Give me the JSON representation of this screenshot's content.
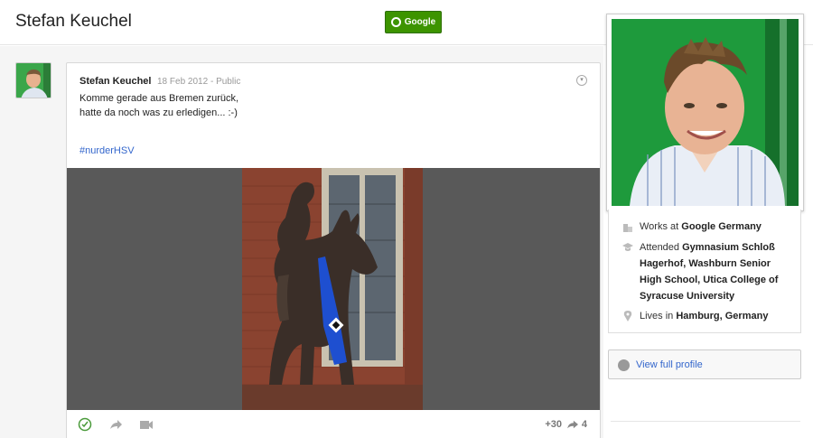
{
  "header": {
    "owner_name": "Stefan Keuchel",
    "google_button_label": "Google"
  },
  "post": {
    "author": "Stefan Keuchel",
    "date": "18 Feb 2012",
    "separator": "-",
    "visibility": "Public",
    "text_line1": "Komme gerade aus Bremen zurück,",
    "text_line2": "hatte da noch was zu erledigen... :-)",
    "hashtag": "#nurderHSV",
    "plus_count": "+30",
    "share_count": "4"
  },
  "about": {
    "works_prefix": "Works at",
    "works_at": "Google Germany",
    "attended_prefix": "Attended",
    "attended": "Gymnasium Schloß Hagerhof, Washburn Senior High School, Utica College of Syracuse University",
    "lives_prefix": "Lives in",
    "lives_in": "Hamburg, Germany"
  },
  "view_profile_label": "View full profile",
  "icons": [
    "options-chevron-icon",
    "plus-one-icon",
    "share-icon",
    "hangout-icon",
    "building-icon",
    "graduation-cap-icon",
    "location-pin-icon",
    "user-icon"
  ],
  "colors": {
    "accent_green": "#3d9400",
    "link_blue": "#3366cc"
  }
}
